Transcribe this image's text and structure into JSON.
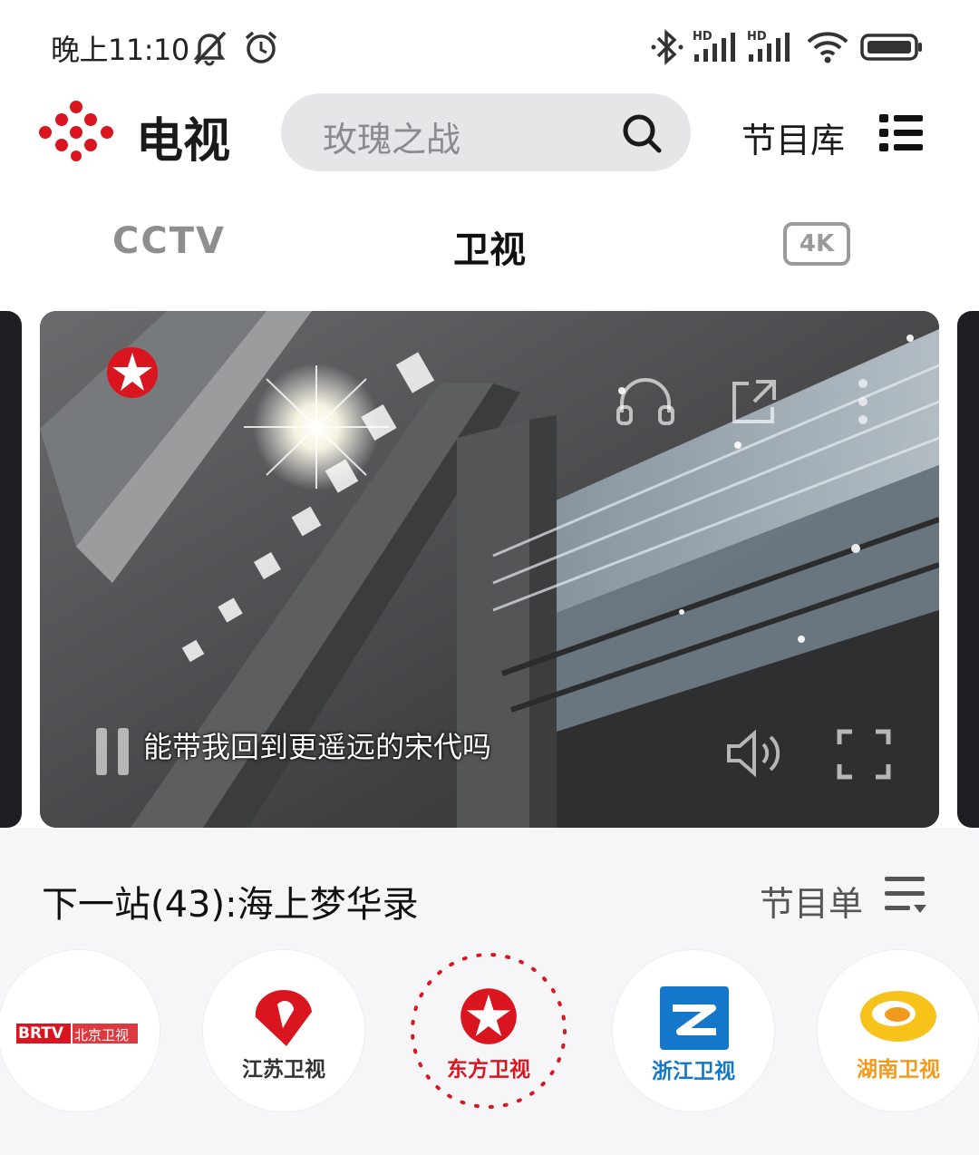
{
  "status_bar": {
    "time": "晚上11:10",
    "icons": [
      "mute-bell-icon",
      "alarm-icon",
      "bluetooth-icon",
      "signal-hd-1-icon",
      "signal-hd-2-icon",
      "wifi-icon",
      "battery-icon"
    ]
  },
  "header": {
    "app_name": "电视",
    "search_placeholder": "玫瑰之战",
    "library_label": "节目库"
  },
  "tabs": [
    {
      "label": "CCTV",
      "active": false
    },
    {
      "label": "卫视",
      "active": true
    },
    {
      "label": "4K",
      "active": false
    }
  ],
  "player": {
    "subtitle": "能带我回到更遥远的宋代吗",
    "channel_logo": "dragon-tv-logo"
  },
  "now": {
    "next_program": "下一站(43):海上梦华录",
    "schedule_label": "节目单"
  },
  "channels": [
    {
      "name": "BRTV 北京卫视",
      "brand": "BRTV",
      "sub": "北京卫视",
      "active": false
    },
    {
      "name": "江苏卫视",
      "active": false
    },
    {
      "name": "东方卫视",
      "active": true
    },
    {
      "name": "浙江卫视",
      "active": false
    },
    {
      "name": "湖南卫视",
      "active": false
    }
  ],
  "colors": {
    "accent_red": "#d9161f",
    "search_bg": "#e6e6e9",
    "zhejiang_blue": "#1477c9",
    "hunan_orange": "#f29a1d"
  }
}
